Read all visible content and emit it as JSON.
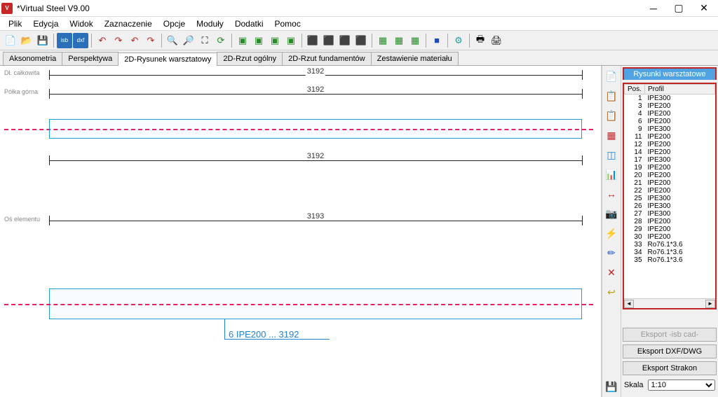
{
  "title": "*Virtual Steel V9.00",
  "menu": [
    "Plik",
    "Edycja",
    "Widok",
    "Zaznaczenie",
    "Opcje",
    "Moduły",
    "Dodatki",
    "Pomoc"
  ],
  "tabs": [
    {
      "label": "Aksonometria",
      "active": false
    },
    {
      "label": "Perspektywa",
      "active": false
    },
    {
      "label": "2D-Rysunek warsztatowy",
      "active": true
    },
    {
      "label": "2D-Rzut ogólny",
      "active": false
    },
    {
      "label": "2D-Rzut fundamentów",
      "active": false
    },
    {
      "label": "Zestawienie materiału",
      "active": false
    }
  ],
  "drawing": {
    "dim1": "3192",
    "dim2": "3192",
    "dim3": "3192",
    "dim4": "3193",
    "label_overall": "Dł. całkowita",
    "label_top_flange": "Półka górna",
    "label_axis": "Oś elementu",
    "callout": "6 IPE200 ... 3192"
  },
  "right_panel": {
    "header": "Rysunki warsztatowe",
    "columns": [
      "Pos.",
      "Profil"
    ],
    "rows": [
      {
        "pos": "1",
        "profil": "IPE300"
      },
      {
        "pos": "3",
        "profil": "IPE200"
      },
      {
        "pos": "4",
        "profil": "IPE200"
      },
      {
        "pos": "6",
        "profil": "IPE200"
      },
      {
        "pos": "9",
        "profil": "IPE300"
      },
      {
        "pos": "11",
        "profil": "IPE200"
      },
      {
        "pos": "12",
        "profil": "IPE200"
      },
      {
        "pos": "14",
        "profil": "IPE200"
      },
      {
        "pos": "17",
        "profil": "IPE300"
      },
      {
        "pos": "19",
        "profil": "IPE200"
      },
      {
        "pos": "20",
        "profil": "IPE200"
      },
      {
        "pos": "21",
        "profil": "IPE200"
      },
      {
        "pos": "22",
        "profil": "IPE200"
      },
      {
        "pos": "25",
        "profil": "IPE300"
      },
      {
        "pos": "26",
        "profil": "IPE300"
      },
      {
        "pos": "27",
        "profil": "IPE300"
      },
      {
        "pos": "28",
        "profil": "IPE200"
      },
      {
        "pos": "29",
        "profil": "IPE200"
      },
      {
        "pos": "30",
        "profil": "IPE200"
      },
      {
        "pos": "33",
        "profil": "Ro76.1*3.6"
      },
      {
        "pos": "34",
        "profil": "Ro76.1*3.6"
      },
      {
        "pos": "35",
        "profil": "Ro76.1*3.6"
      }
    ],
    "btn_isb": "Eksport -isb cad-",
    "btn_dxf": "Eksport DXF/DWG",
    "btn_strakon": "Eksport Strakon",
    "scale_label": "Skala",
    "scale_value": "1:10"
  }
}
